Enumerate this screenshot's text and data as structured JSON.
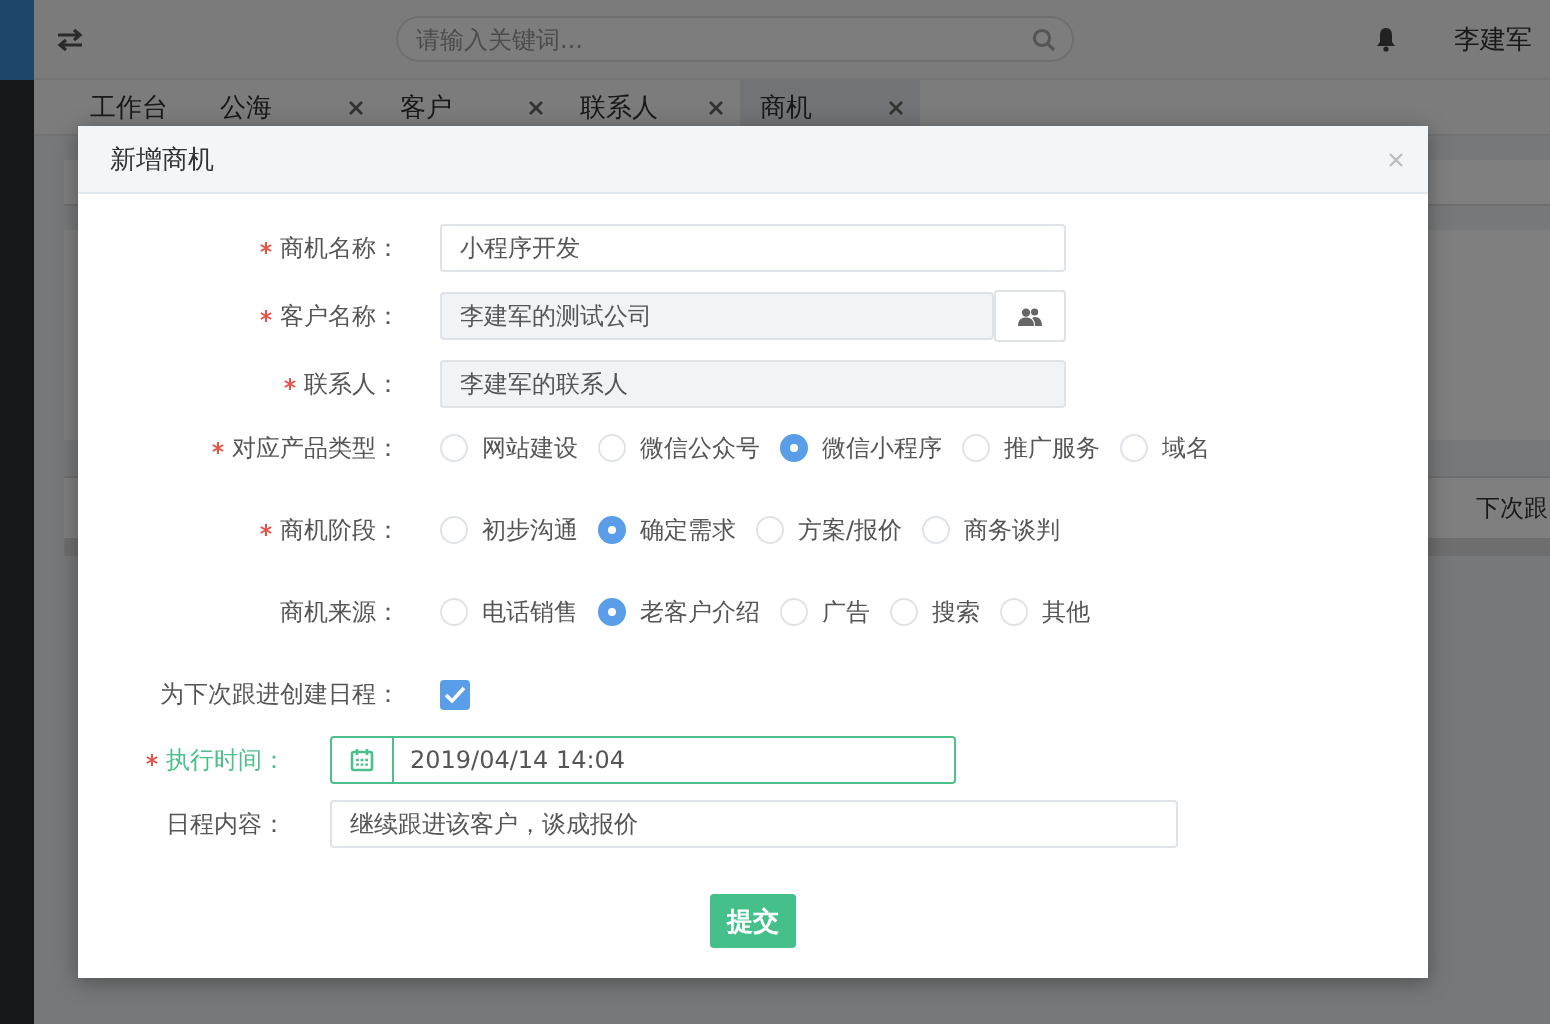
{
  "header": {
    "search": {
      "placeholder": "请输入关键词..."
    },
    "user": "李建军"
  },
  "tabs": [
    {
      "label": "工作台",
      "closable": false,
      "selected": false
    },
    {
      "label": "公海",
      "closable": true,
      "selected": false
    },
    {
      "label": "客户",
      "closable": true,
      "selected": false
    },
    {
      "label": "联系人",
      "closable": true,
      "selected": false
    },
    {
      "label": "商机",
      "closable": true,
      "selected": true
    }
  ],
  "background": {
    "column_heading": "下次跟"
  },
  "dialog": {
    "title": "新增商机",
    "sections": [
      {
        "kind": "wide",
        "rows": [
          {
            "kind": "text",
            "label": "商机名称：",
            "required": true,
            "value": "小程序开发",
            "readonly": false
          },
          {
            "kind": "picker",
            "label": "客户名称：",
            "required": true,
            "value": "李建军的测试公司",
            "readonly": true
          },
          {
            "kind": "text",
            "label": "联系人：",
            "required": true,
            "value": "李建军的联系人",
            "readonly": true
          },
          {
            "kind": "radio",
            "label": "对应产品类型：",
            "required": true,
            "options": [
              {
                "label": "网站建设",
                "selected": false
              },
              {
                "label": "微信公众号",
                "selected": false
              },
              {
                "label": "微信小程序",
                "selected": true
              },
              {
                "label": "推广服务",
                "selected": false
              },
              {
                "label": "域名",
                "selected": false
              }
            ]
          },
          {
            "kind": "radio",
            "label": "商机阶段：",
            "required": true,
            "options": [
              {
                "label": "初步沟通",
                "selected": false
              },
              {
                "label": "确定需求",
                "selected": true
              },
              {
                "label": "方案/报价",
                "selected": false
              },
              {
                "label": "商务谈判",
                "selected": false
              }
            ]
          },
          {
            "kind": "radio",
            "label": "商机来源：",
            "required": false,
            "options": [
              {
                "label": "电话销售",
                "selected": false
              },
              {
                "label": "老客户介绍",
                "selected": true
              },
              {
                "label": "广告",
                "selected": false
              },
              {
                "label": "搜索",
                "selected": false
              },
              {
                "label": "其他",
                "selected": false
              }
            ]
          },
          {
            "kind": "checkbox",
            "label": "为下次跟进创建日程：",
            "required": false,
            "checked": true
          }
        ]
      },
      {
        "kind": "compact",
        "rows": [
          {
            "kind": "datetime",
            "label": "执行时间：",
            "required": true,
            "value": "2019/04/14 14:04",
            "focused": true
          },
          {
            "kind": "note",
            "label": "日程内容：",
            "required": false,
            "value": "继续跟进该客户，谈成报价",
            "focused": false
          }
        ]
      }
    ],
    "submit": "提交"
  }
}
